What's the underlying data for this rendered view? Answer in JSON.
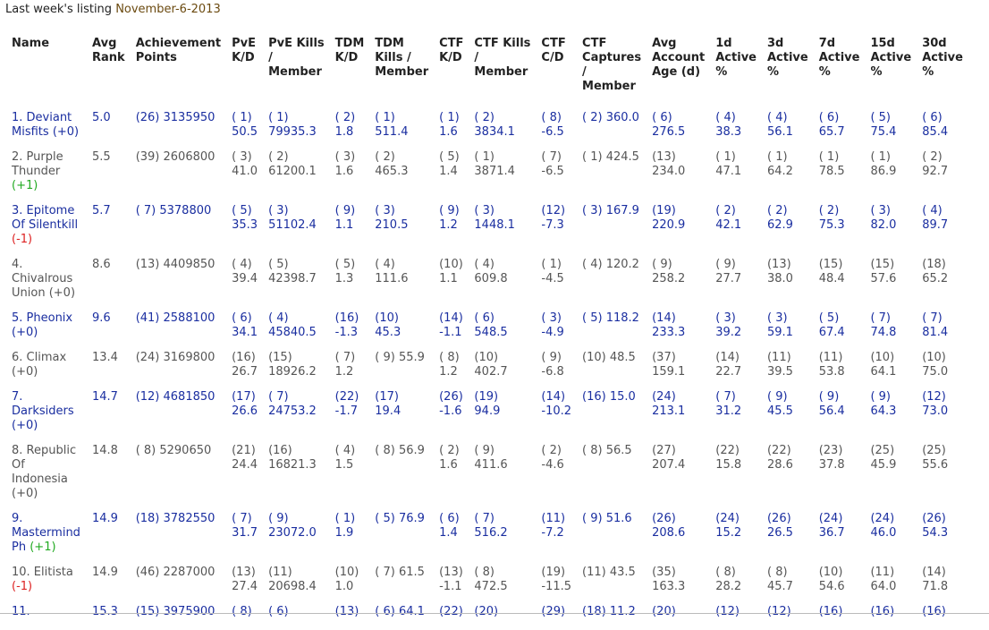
{
  "header": {
    "title_prefix": "Last week's listing",
    "title_date": "November-6-2013"
  },
  "columns": [
    {
      "key": "name",
      "l1": "Name",
      "l2": "",
      "l3": "",
      "l4": ""
    },
    {
      "key": "avg_rank",
      "l1": "Avg",
      "l2": "Rank",
      "l3": "",
      "l4": ""
    },
    {
      "key": "ach",
      "l1": "Achievement",
      "l2": "Points",
      "l3": "",
      "l4": ""
    },
    {
      "key": "pve_kd",
      "l1": "PvE",
      "l2": "K/D",
      "l3": "",
      "l4": ""
    },
    {
      "key": "pve_kills",
      "l1": "PvE Kills",
      "l2": "/",
      "l3": "Member",
      "l4": ""
    },
    {
      "key": "tdm_kd",
      "l1": "TDM",
      "l2": "K/D",
      "l3": "",
      "l4": ""
    },
    {
      "key": "tdm_kills",
      "l1": "TDM",
      "l2": "Kills /",
      "l3": "Member",
      "l4": ""
    },
    {
      "key": "ctf_kd",
      "l1": "CTF",
      "l2": "K/D",
      "l3": "",
      "l4": ""
    },
    {
      "key": "ctf_kills",
      "l1": "CTF Kills",
      "l2": "/",
      "l3": "Member",
      "l4": ""
    },
    {
      "key": "ctf_cd",
      "l1": "CTF",
      "l2": "C/D",
      "l3": "",
      "l4": ""
    },
    {
      "key": "ctf_caps",
      "l1": "CTF",
      "l2": "Captures",
      "l3": "/",
      "l4": "Member"
    },
    {
      "key": "age",
      "l1": "Avg",
      "l2": "Account",
      "l3": "Age (d)",
      "l4": ""
    },
    {
      "key": "a1",
      "l1": "1d",
      "l2": "Active",
      "l3": "%",
      "l4": ""
    },
    {
      "key": "a3",
      "l1": "3d",
      "l2": "Active",
      "l3": "%",
      "l4": ""
    },
    {
      "key": "a7",
      "l1": "7d",
      "l2": "Active",
      "l3": "%",
      "l4": ""
    },
    {
      "key": "a15",
      "l1": "15d",
      "l2": "Active",
      "l3": "%",
      "l4": ""
    },
    {
      "key": "a30",
      "l1": "30d",
      "l2": "Active",
      "l3": "%",
      "l4": ""
    }
  ],
  "rows": [
    {
      "color": "blue",
      "name": "1. Deviant Misfits",
      "change": "(+0)",
      "change_type": "zero",
      "avg_rank": "5.0",
      "ach": "(26) 3135950",
      "pve_kd": [
        "( 1)",
        "50.5"
      ],
      "pve_kills": [
        "( 1)",
        "79935.3"
      ],
      "tdm_kd": [
        "( 2)",
        "1.8"
      ],
      "tdm_kills": [
        "( 1)",
        "511.4"
      ],
      "ctf_kd": [
        "( 1)",
        "1.6"
      ],
      "ctf_kills": [
        "( 2)",
        "3834.1"
      ],
      "ctf_cd": [
        "( 8)",
        "-6.5"
      ],
      "ctf_caps": [
        "( 2) 360.0"
      ],
      "age": [
        "( 6)",
        "276.5"
      ],
      "a1": [
        "( 4)",
        "38.3"
      ],
      "a3": [
        "( 4)",
        "56.1"
      ],
      "a7": [
        "( 6)",
        "65.7"
      ],
      "a15": [
        "( 5)",
        "75.4"
      ],
      "a30": [
        "( 6)",
        "85.4"
      ]
    },
    {
      "color": "gray",
      "name": "2. Purple Thunder",
      "change": "(+1)",
      "change_type": "pos",
      "avg_rank": "5.5",
      "ach": "(39) 2606800",
      "pve_kd": [
        "( 3)",
        "41.0"
      ],
      "pve_kills": [
        "( 2)",
        "61200.1"
      ],
      "tdm_kd": [
        "( 3)",
        "1.6"
      ],
      "tdm_kills": [
        "( 2)",
        "465.3"
      ],
      "ctf_kd": [
        "( 5)",
        "1.4"
      ],
      "ctf_kills": [
        "( 1)",
        "3871.4"
      ],
      "ctf_cd": [
        "( 7)",
        "-6.5"
      ],
      "ctf_caps": [
        "( 1) 424.5"
      ],
      "age": [
        "(13)",
        "234.0"
      ],
      "a1": [
        "( 1)",
        "47.1"
      ],
      "a3": [
        "( 1)",
        "64.2"
      ],
      "a7": [
        "( 1)",
        "78.5"
      ],
      "a15": [
        "( 1)",
        "86.9"
      ],
      "a30": [
        "( 2)",
        "92.7"
      ]
    },
    {
      "color": "blue",
      "name": "3. Epitome Of Silentkill",
      "change": "(-1)",
      "change_type": "neg",
      "avg_rank": "5.7",
      "ach": "( 7) 5378800",
      "pve_kd": [
        "( 5)",
        "35.3"
      ],
      "pve_kills": [
        "( 3)",
        "51102.4"
      ],
      "tdm_kd": [
        "( 9)",
        "1.1"
      ],
      "tdm_kills": [
        "( 3)",
        "210.5"
      ],
      "ctf_kd": [
        "( 9)",
        "1.2"
      ],
      "ctf_kills": [
        "( 3)",
        "1448.1"
      ],
      "ctf_cd": [
        "(12)",
        "-7.3"
      ],
      "ctf_caps": [
        "( 3) 167.9"
      ],
      "age": [
        "(19)",
        "220.9"
      ],
      "a1": [
        "( 2)",
        "42.1"
      ],
      "a3": [
        "( 2)",
        "62.9"
      ],
      "a7": [
        "( 2)",
        "75.3"
      ],
      "a15": [
        "( 3)",
        "82.0"
      ],
      "a30": [
        "( 4)",
        "89.7"
      ]
    },
    {
      "color": "gray",
      "name": "4. Chivalrous Union",
      "change": "(+0)",
      "change_type": "zero",
      "avg_rank": "8.6",
      "ach": "(13) 4409850",
      "pve_kd": [
        "( 4)",
        "39.4"
      ],
      "pve_kills": [
        "( 5)",
        "42398.7"
      ],
      "tdm_kd": [
        "( 5)",
        "1.3"
      ],
      "tdm_kills": [
        "( 4)",
        "111.6"
      ],
      "ctf_kd": [
        "(10)",
        "1.1"
      ],
      "ctf_kills": [
        "( 4)",
        "609.8"
      ],
      "ctf_cd": [
        "( 1)",
        "-4.5"
      ],
      "ctf_caps": [
        "( 4) 120.2"
      ],
      "age": [
        "( 9)",
        "258.2"
      ],
      "a1": [
        "( 9)",
        "27.7"
      ],
      "a3": [
        "(13)",
        "38.0"
      ],
      "a7": [
        "(15)",
        "48.4"
      ],
      "a15": [
        "(15)",
        "57.6"
      ],
      "a30": [
        "(18)",
        "65.2"
      ]
    },
    {
      "color": "blue",
      "name": "5. Pheonix",
      "change": "(+0)",
      "change_type": "zero",
      "avg_rank": "9.6",
      "ach": "(41) 2588100",
      "pve_kd": [
        "( 6)",
        "34.1"
      ],
      "pve_kills": [
        "( 4)",
        "45840.5"
      ],
      "tdm_kd": [
        "(16)",
        "-1.3"
      ],
      "tdm_kills": [
        "(10)",
        "45.3"
      ],
      "ctf_kd": [
        "(14)",
        "-1.1"
      ],
      "ctf_kills": [
        "( 6)",
        "548.5"
      ],
      "ctf_cd": [
        "( 3)",
        "-4.9"
      ],
      "ctf_caps": [
        "( 5) 118.2"
      ],
      "age": [
        "(14)",
        "233.3"
      ],
      "a1": [
        "( 3)",
        "39.2"
      ],
      "a3": [
        "( 3)",
        "59.1"
      ],
      "a7": [
        "( 5)",
        "67.4"
      ],
      "a15": [
        "( 7)",
        "74.8"
      ],
      "a30": [
        "( 7)",
        "81.4"
      ]
    },
    {
      "color": "gray",
      "name": "6. Climax",
      "change": "(+0)",
      "change_type": "zero",
      "avg_rank": "13.4",
      "ach": "(24) 3169800",
      "pve_kd": [
        "(16)",
        "26.7"
      ],
      "pve_kills": [
        "(15)",
        "18926.2"
      ],
      "tdm_kd": [
        "( 7)",
        "1.2"
      ],
      "tdm_kills": [
        "( 9) 55.9"
      ],
      "ctf_kd": [
        "( 8)",
        "1.2"
      ],
      "ctf_kills": [
        "(10)",
        "402.7"
      ],
      "ctf_cd": [
        "( 9)",
        "-6.8"
      ],
      "ctf_caps": [
        "(10) 48.5"
      ],
      "age": [
        "(37)",
        "159.1"
      ],
      "a1": [
        "(14)",
        "22.7"
      ],
      "a3": [
        "(11)",
        "39.5"
      ],
      "a7": [
        "(11)",
        "53.8"
      ],
      "a15": [
        "(10)",
        "64.1"
      ],
      "a30": [
        "(10)",
        "75.0"
      ]
    },
    {
      "color": "blue",
      "name": "7. Darksiders",
      "change": "(+0)",
      "change_type": "zero",
      "avg_rank": "14.7",
      "ach": "(12) 4681850",
      "pve_kd": [
        "(17)",
        "26.6"
      ],
      "pve_kills": [
        "( 7)",
        "24753.2"
      ],
      "tdm_kd": [
        "(22)",
        "-1.7"
      ],
      "tdm_kills": [
        "(17)",
        "19.4"
      ],
      "ctf_kd": [
        "(26)",
        "-1.6"
      ],
      "ctf_kills": [
        "(19)",
        "94.9"
      ],
      "ctf_cd": [
        "(14)",
        "-10.2"
      ],
      "ctf_caps": [
        "(16) 15.0"
      ],
      "age": [
        "(24)",
        "213.1"
      ],
      "a1": [
        "( 7)",
        "31.2"
      ],
      "a3": [
        "( 9)",
        "45.5"
      ],
      "a7": [
        "( 9)",
        "56.4"
      ],
      "a15": [
        "( 9)",
        "64.3"
      ],
      "a30": [
        "(12)",
        "73.0"
      ]
    },
    {
      "color": "gray",
      "name": "8. Republic Of Indonesia",
      "change": "(+0)",
      "change_type": "zero",
      "avg_rank": "14.8",
      "ach": "( 8) 5290650",
      "pve_kd": [
        "(21)",
        "24.4"
      ],
      "pve_kills": [
        "(16)",
        "16821.3"
      ],
      "tdm_kd": [
        "( 4)",
        "1.5"
      ],
      "tdm_kills": [
        "( 8) 56.9"
      ],
      "ctf_kd": [
        "( 2)",
        "1.6"
      ],
      "ctf_kills": [
        "( 9)",
        "411.6"
      ],
      "ctf_cd": [
        "( 2)",
        "-4.6"
      ],
      "ctf_caps": [
        "( 8) 56.5"
      ],
      "age": [
        "(27)",
        "207.4"
      ],
      "a1": [
        "(22)",
        "15.8"
      ],
      "a3": [
        "(22)",
        "28.6"
      ],
      "a7": [
        "(23)",
        "37.8"
      ],
      "a15": [
        "(25)",
        "45.9"
      ],
      "a30": [
        "(25)",
        "55.6"
      ]
    },
    {
      "color": "blue",
      "name": "9. Mastermind Ph",
      "change": "(+1)",
      "change_type": "pos",
      "avg_rank": "14.9",
      "ach": "(18) 3782550",
      "pve_kd": [
        "( 7)",
        "31.7"
      ],
      "pve_kills": [
        "( 9)",
        "23072.0"
      ],
      "tdm_kd": [
        "( 1)",
        "1.9"
      ],
      "tdm_kills": [
        "( 5) 76.9"
      ],
      "ctf_kd": [
        "( 6)",
        "1.4"
      ],
      "ctf_kills": [
        "( 7)",
        "516.2"
      ],
      "ctf_cd": [
        "(11)",
        "-7.2"
      ],
      "ctf_caps": [
        "( 9) 51.6"
      ],
      "age": [
        "(26)",
        "208.6"
      ],
      "a1": [
        "(24)",
        "15.2"
      ],
      "a3": [
        "(26)",
        "26.5"
      ],
      "a7": [
        "(24)",
        "36.7"
      ],
      "a15": [
        "(24)",
        "46.0"
      ],
      "a30": [
        "(26)",
        "54.3"
      ]
    },
    {
      "color": "gray",
      "name": "10. Elitista",
      "change": "(-1)",
      "change_type": "neg",
      "avg_rank": "14.9",
      "ach": "(46) 2287000",
      "pve_kd": [
        "(13)",
        "27.4"
      ],
      "pve_kills": [
        "(11)",
        "20698.4"
      ],
      "tdm_kd": [
        "(10)",
        "1.0"
      ],
      "tdm_kills": [
        "( 7) 61.5"
      ],
      "ctf_kd": [
        "(13)",
        "-1.1"
      ],
      "ctf_kills": [
        "( 8)",
        "472.5"
      ],
      "ctf_cd": [
        "(19)",
        "-11.5"
      ],
      "ctf_caps": [
        "(11) 43.5"
      ],
      "age": [
        "(35)",
        "163.3"
      ],
      "a1": [
        "( 8)",
        "28.2"
      ],
      "a3": [
        "( 8)",
        "45.7"
      ],
      "a7": [
        "(10)",
        "54.6"
      ],
      "a15": [
        "(11)",
        "64.0"
      ],
      "a30": [
        "(14)",
        "71.8"
      ]
    },
    {
      "color": "blue",
      "name": "11.",
      "change": "",
      "change_type": "zero",
      "avg_rank": "15.3",
      "ach": "(15) 3975900",
      "pve_kd": [
        "( 8)",
        ""
      ],
      "pve_kills": [
        "( 6)",
        ""
      ],
      "tdm_kd": [
        "(13)",
        ""
      ],
      "tdm_kills": [
        "( 6) 64.1"
      ],
      "ctf_kd": [
        "(22)",
        ""
      ],
      "ctf_kills": [
        "(20)",
        ""
      ],
      "ctf_cd": [
        "(29)",
        ""
      ],
      "ctf_caps": [
        "(18) 11.2"
      ],
      "age": [
        "(20)",
        ""
      ],
      "a1": [
        "(12)",
        ""
      ],
      "a3": [
        "(12)",
        ""
      ],
      "a7": [
        "(16)",
        ""
      ],
      "a15": [
        "(16)",
        ""
      ],
      "a30": [
        "(16)",
        ""
      ]
    }
  ]
}
